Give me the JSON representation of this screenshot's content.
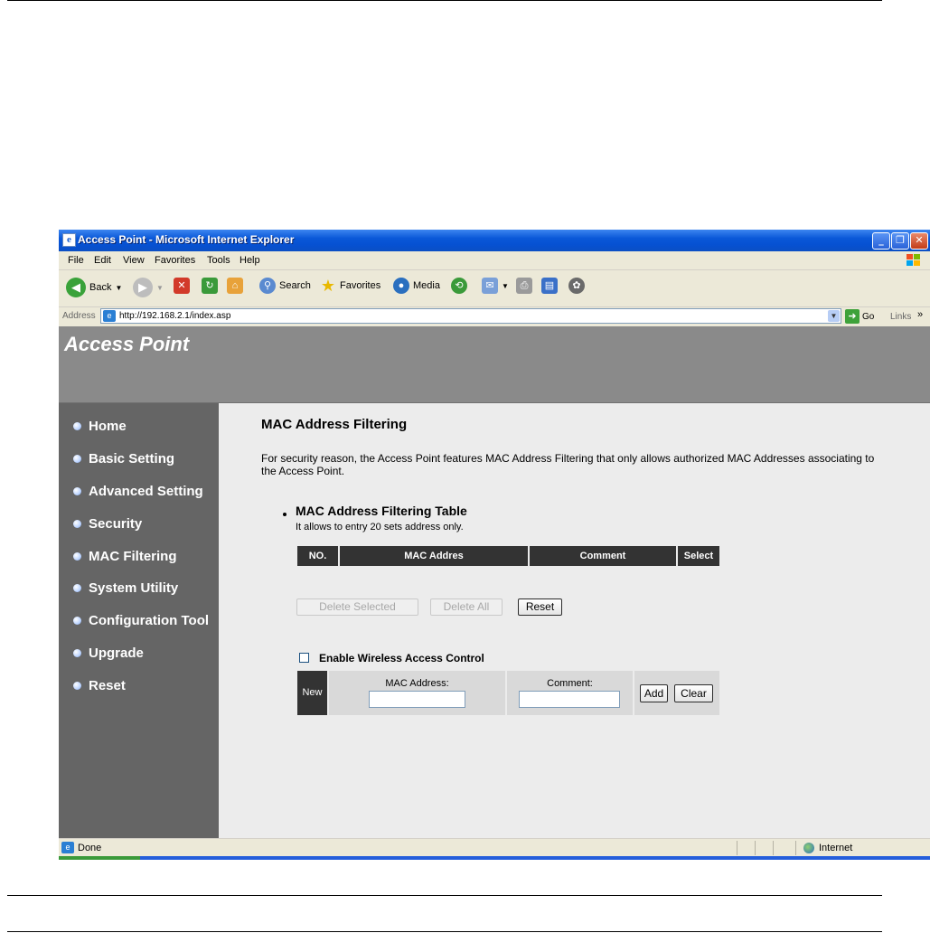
{
  "window": {
    "title": "Access Point - Microsoft Internet Explorer",
    "minimize_glyph": "_",
    "restore_glyph": "❐",
    "close_glyph": "✕"
  },
  "menubar": {
    "items": [
      "File",
      "Edit",
      "View",
      "Favorites",
      "Tools",
      "Help"
    ]
  },
  "toolbar": {
    "back_label": "Back",
    "search_label": "Search",
    "favorites_label": "Favorites",
    "media_label": "Media"
  },
  "addressbar": {
    "label": "Address",
    "url": "http://192.168.2.1/index.asp",
    "go_label": "Go",
    "links_label": "Links"
  },
  "banner": {
    "title": "Access Point"
  },
  "sidebar": {
    "items": [
      {
        "label": "Home"
      },
      {
        "label": "Basic Setting"
      },
      {
        "label": "Advanced Setting"
      },
      {
        "label": "Security"
      },
      {
        "label": "MAC Filtering"
      },
      {
        "label": "System Utility"
      },
      {
        "label": "Configuration Tool"
      },
      {
        "label": "Upgrade"
      },
      {
        "label": "Reset"
      }
    ]
  },
  "main": {
    "title": "MAC Address Filtering",
    "description": "For security reason, the Access Point features MAC Address Filtering that only allows authorized MAC Addresses associating to the Access Point.",
    "section_title": "MAC Address Filtering Table",
    "section_subtitle": "It allows to entry 20 sets address only.",
    "table_headers": [
      "NO.",
      "MAC Addres",
      "Comment",
      "Select"
    ],
    "buttons": {
      "delete_selected": "Delete Selected",
      "delete_all": "Delete All",
      "reset": "Reset"
    },
    "enable_checkbox_label": "Enable Wireless Access Control",
    "enable_checked": false,
    "form": {
      "new_label": "New",
      "mac_label": "MAC Address:",
      "mac_value": "",
      "comment_label": "Comment:",
      "comment_value": "",
      "add_label": "Add",
      "clear_label": "Clear"
    }
  },
  "statusbar": {
    "status": "Done",
    "zone": "Internet"
  }
}
